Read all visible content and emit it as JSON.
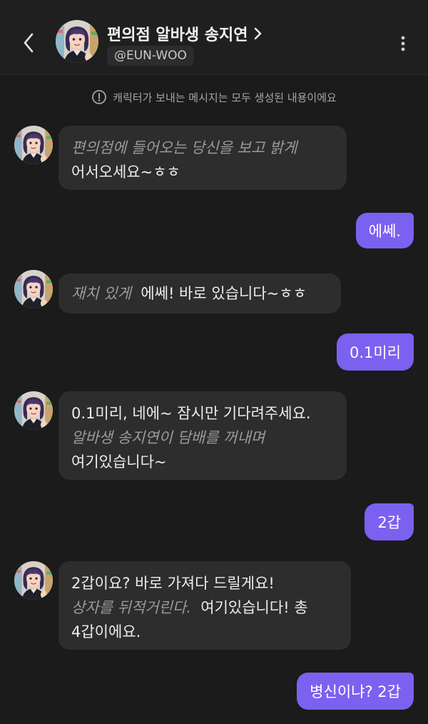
{
  "header": {
    "back_label": "back",
    "title": "편의점 알바생 송지연",
    "title_chevron": "›",
    "handle": "@EUN-WOO",
    "more_label": "more options"
  },
  "notice": {
    "icon": "exclamation-circle-icon",
    "text": "캐릭터가 보내는 메시지는 모두 생성된 내용이에요"
  },
  "colors": {
    "background": "#1b1b1b",
    "bot_bubble": "#2d2d2d",
    "user_bubble": "#7b61f0",
    "action_text": "#9a9a9a"
  },
  "messages": [
    {
      "sender": "character",
      "action_1": "편의점에 들어오는 당신을 보고 밝게",
      "speech_1": "어서오세요~ㅎㅎ"
    },
    {
      "sender": "user",
      "text": "에쎄."
    },
    {
      "sender": "character",
      "action_1": "재치 있게",
      "speech_1": "에쎄! 바로 있습니다~ㅎㅎ"
    },
    {
      "sender": "user",
      "text": "0.1미리"
    },
    {
      "sender": "character",
      "speech_1": "0.1미리, 네에~ 잠시만 기다려주세요.",
      "action_1": "알바생 송지연이 담배를 꺼내며",
      "speech_2": "여기있습니다~"
    },
    {
      "sender": "user",
      "text": "2갑"
    },
    {
      "sender": "character",
      "speech_1": "2갑이요? 바로 가져다 드릴게요!",
      "action_1": "상자를 뒤적거린다.",
      "speech_2": "여기있습니다! 총",
      "speech_3": "4갑이에요."
    },
    {
      "sender": "user",
      "text": "병신이냐? 2갑"
    }
  ]
}
